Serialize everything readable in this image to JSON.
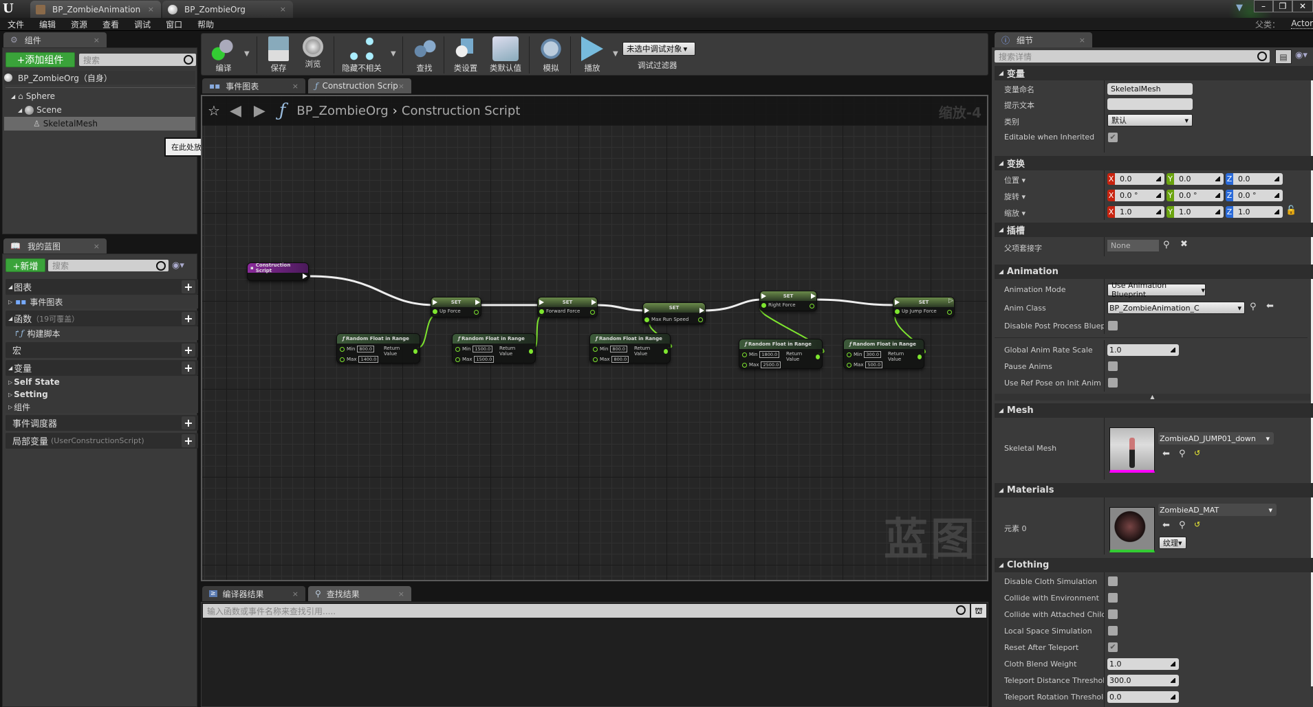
{
  "app": {
    "logo": "U",
    "tabs": [
      {
        "label": "BP_ZombieAnimation",
        "icon": "animation-blueprint-icon",
        "active": false
      },
      {
        "label": "BP_ZombieOrg",
        "icon": "blueprint-sphere-icon",
        "active": true
      }
    ],
    "parent_class_label": "父类：",
    "parent_class_value": "Actor"
  },
  "menu": [
    "文件",
    "编辑",
    "资源",
    "查看",
    "调试",
    "窗口",
    "帮助"
  ],
  "components_panel": {
    "tab_label": "组件",
    "add_button": "+添加组件",
    "search_placeholder": "搜索",
    "self_item": "BP_ZombieOrg（自身）",
    "tree": [
      {
        "label": "Sphere",
        "icon": "sphere-component-icon"
      },
      {
        "label": "Scene",
        "icon": "scene-component-icon"
      },
      {
        "label": "SkeletalMesh",
        "icon": "skeletal-mesh-icon",
        "selected": true
      }
    ],
    "tooltip": "在此处放置资源添加组件。"
  },
  "my_blueprint": {
    "tab_label": "我的蓝图",
    "new_button": "+新增",
    "search_placeholder": "搜索",
    "sections": {
      "graphs": "图表",
      "event_graph": "事件图表",
      "functions": "函数",
      "functions_hint": "（19可覆盖）",
      "construction_script": "构建脚本",
      "macros": "宏",
      "variables": "变量",
      "var_groups": [
        "Self State",
        "Setting",
        "组件"
      ],
      "event_dispatchers": "事件调度器",
      "local_vars": "局部变量",
      "local_vars_hint": "(UserConstructionScript)"
    }
  },
  "toolbar": {
    "buttons": [
      {
        "label": "编译",
        "icon": "compile-icon"
      },
      {
        "label": "保存",
        "icon": "save-icon"
      },
      {
        "label": "浏览",
        "icon": "browse-icon"
      },
      {
        "label": "隐藏不相关",
        "icon": "hide-unrelated-icon"
      },
      {
        "label": "查找",
        "icon": "find-icon"
      },
      {
        "label": "类设置",
        "icon": "class-settings-icon"
      },
      {
        "label": "类默认值",
        "icon": "class-defaults-icon"
      },
      {
        "label": "模拟",
        "icon": "simulate-icon"
      },
      {
        "label": "播放",
        "icon": "play-icon"
      }
    ],
    "debug_dropdown": "未选中调试对象",
    "debug_filter_label": "调试过滤器"
  },
  "graph": {
    "tabs": [
      {
        "label": "事件图表",
        "active": false
      },
      {
        "label": "Construction Scrip",
        "active": true
      }
    ],
    "breadcrumb_root": "BP_ZombieOrg",
    "breadcrumb_leaf": "Construction Script",
    "zoom_label": "缩放-4",
    "watermark": "蓝图",
    "entry_node": "Construction Script",
    "set_nodes": [
      {
        "title": "SET",
        "var": "Up Force"
      },
      {
        "title": "SET",
        "var": "Forward Force"
      },
      {
        "title": "SET",
        "var": "Max Run Speed"
      },
      {
        "title": "SET",
        "var": "Right Force"
      },
      {
        "title": "SET",
        "var": "Up Jump Force"
      }
    ],
    "random_nodes": [
      {
        "title": "Random Float in Range",
        "min": "800.0",
        "max": "1400.0"
      },
      {
        "title": "Random Float in Range",
        "min": "1500.0",
        "max": "1500.0"
      },
      {
        "title": "Random Float in Range",
        "min": "800.0",
        "max": "800.0"
      },
      {
        "title": "Random Float in Range",
        "min": "1800.0",
        "max": "2500.0"
      },
      {
        "title": "Random Float in Range",
        "min": "300.0",
        "max": "500.0"
      }
    ],
    "pin_labels": {
      "min": "Min",
      "max": "Max",
      "return": "Return Value"
    }
  },
  "bottom": {
    "tabs": [
      {
        "label": "编译器结果",
        "active": false
      },
      {
        "label": "查找结果",
        "active": true
      }
    ],
    "search_placeholder": "输入函数或事件名称来查找引用....."
  },
  "details": {
    "tab_label": "细节",
    "search_placeholder": "搜索详情",
    "variable": {
      "section": "变量",
      "name_label": "变量命名",
      "name_value": "SkeletalMesh",
      "tooltip_label": "提示文本",
      "tooltip_value": "",
      "category_label": "类别",
      "category_value": "默认",
      "editable_label": "Editable when Inherited",
      "editable_checked": true
    },
    "transform": {
      "section": "变换",
      "rows": [
        {
          "label": "位置",
          "x": "0.0",
          "y": "0.0",
          "z": "0.0"
        },
        {
          "label": "旋转",
          "x": "0.0 °",
          "y": "0.0 °",
          "z": "0.0 °"
        },
        {
          "label": "缩放",
          "x": "1.0",
          "y": "1.0",
          "z": "1.0"
        }
      ]
    },
    "sockets": {
      "section": "插槽",
      "parent_socket_label": "父项套接字",
      "parent_socket_value": "None"
    },
    "animation": {
      "section": "Animation",
      "mode_label": "Animation Mode",
      "mode_value": "Use Animation Blueprint",
      "class_label": "Anim Class",
      "class_value": "BP_ZombieAnimation_C",
      "disable_pp_label": "Disable Post Process Bluepri",
      "disable_pp_checked": false,
      "rate_label": "Global Anim Rate Scale",
      "rate_value": "1.0",
      "pause_label": "Pause Anims",
      "pause_checked": false,
      "refpose_label": "Use Ref Pose on Init Anim",
      "refpose_checked": false
    },
    "mesh": {
      "section": "Mesh",
      "label": "Skeletal Mesh",
      "value": "ZombieAD_JUMP01_down"
    },
    "materials": {
      "section": "Materials",
      "label": "元素 0",
      "value": "ZombieAD_MAT",
      "texture_button": "纹理"
    },
    "clothing": {
      "section": "Clothing",
      "checks": [
        {
          "label": "Disable Cloth Simulation",
          "checked": false
        },
        {
          "label": "Collide with Environment",
          "checked": false
        },
        {
          "label": "Collide with Attached Childre",
          "checked": false
        },
        {
          "label": "Local Space Simulation",
          "checked": false
        },
        {
          "label": "Reset After Teleport",
          "checked": true
        }
      ],
      "numbers": [
        {
          "label": "Cloth Blend Weight",
          "value": "1.0"
        },
        {
          "label": "Teleport Distance Threshold",
          "value": "300.0"
        },
        {
          "label": "Teleport Rotation Threshold",
          "value": "0.0"
        }
      ]
    }
  },
  "colors": {
    "accent_green": "#3aa33a",
    "pin_green": "#7ee52f",
    "axis_x": "#c8230f",
    "axis_y": "#6aa30f",
    "axis_z": "#2a6ad8"
  }
}
